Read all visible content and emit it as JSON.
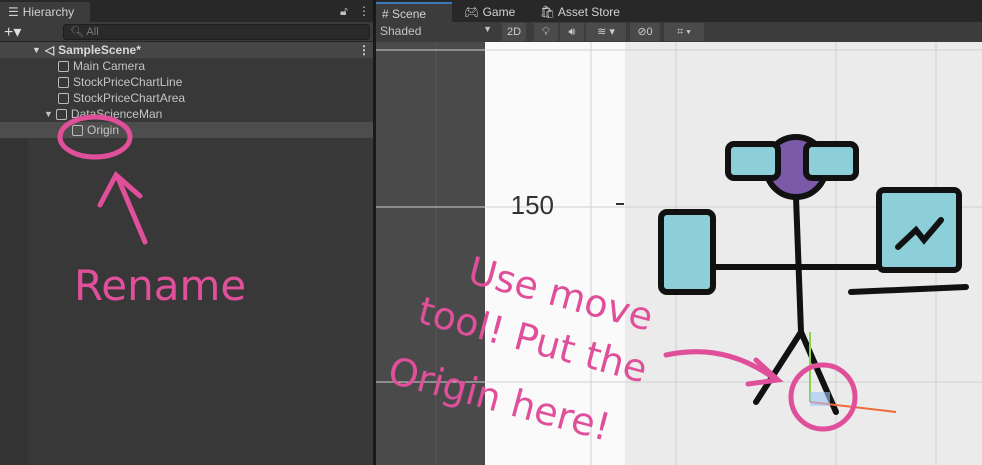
{
  "hierarchy": {
    "title": "Hierarchy",
    "search_placeholder": "All",
    "scene": "SampleScene*",
    "items": [
      "Main Camera",
      "StockPriceChartLine",
      "StockPriceChartArea",
      "DataScienceMan",
      "Origin"
    ]
  },
  "scene": {
    "tabs": [
      "Scene",
      "Game",
      "Asset Store"
    ],
    "shading": "Shaded",
    "btn_2d": "2D",
    "hidden_count": "0",
    "axis_label": "150"
  },
  "annotations": {
    "rename": "Rename",
    "instruction_line1": "Use move",
    "instruction_line2": "tool! Put the",
    "instruction_line3": "Origin here!"
  },
  "colors": {
    "annotation": "#e0509a",
    "selected_row": "#4d4d4d"
  }
}
